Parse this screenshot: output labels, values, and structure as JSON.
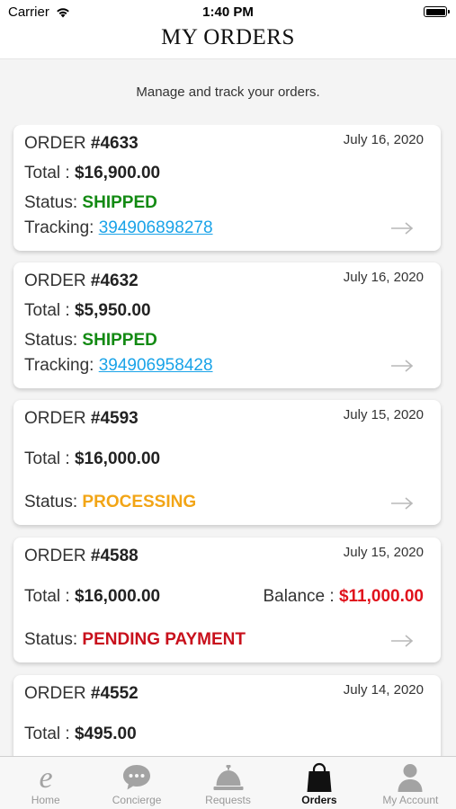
{
  "status_bar": {
    "carrier": "Carrier",
    "time": "1:40 PM"
  },
  "header": {
    "title": "MY ORDERS"
  },
  "subtitle": "Manage and track your orders.",
  "labels": {
    "order": "ORDER ",
    "total": "Total : ",
    "status": "Status: ",
    "tracking": "Tracking: ",
    "balance": "Balance : "
  },
  "orders": [
    {
      "number": "#4633",
      "date": "July 16, 2020",
      "total": "$16,900.00",
      "status": "SHIPPED",
      "status_color": "#138a13",
      "tracking": "394906898278"
    },
    {
      "number": "#4632",
      "date": "July 16, 2020",
      "total": "$5,950.00",
      "status": "SHIPPED",
      "status_color": "#138a13",
      "tracking": "394906958428"
    },
    {
      "number": "#4593",
      "date": "July 15, 2020",
      "total": "$16,000.00",
      "status": "PROCESSING",
      "status_color": "#f2a516"
    },
    {
      "number": "#4588",
      "date": "July 15, 2020",
      "total": "$16,000.00",
      "balance": "$11,000.00",
      "status": "PENDING PAYMENT",
      "status_color": "#c8101c"
    },
    {
      "number": "#4552",
      "date": "July 14, 2020",
      "total": "$495.00"
    }
  ],
  "tabs": [
    {
      "label": "Home",
      "icon": "home-e-icon",
      "active": false
    },
    {
      "label": "Concierge",
      "icon": "chat-bubble-icon",
      "active": false
    },
    {
      "label": "Requests",
      "icon": "service-bell-icon",
      "active": false
    },
    {
      "label": "Orders",
      "icon": "shopping-bag-icon",
      "active": true
    },
    {
      "label": "My Account",
      "icon": "person-icon",
      "active": false
    }
  ],
  "colors": {
    "link": "#1aa3e8",
    "shipped": "#138a13",
    "processing": "#f2a516",
    "pending": "#c8101c",
    "balance": "#e0121c"
  }
}
